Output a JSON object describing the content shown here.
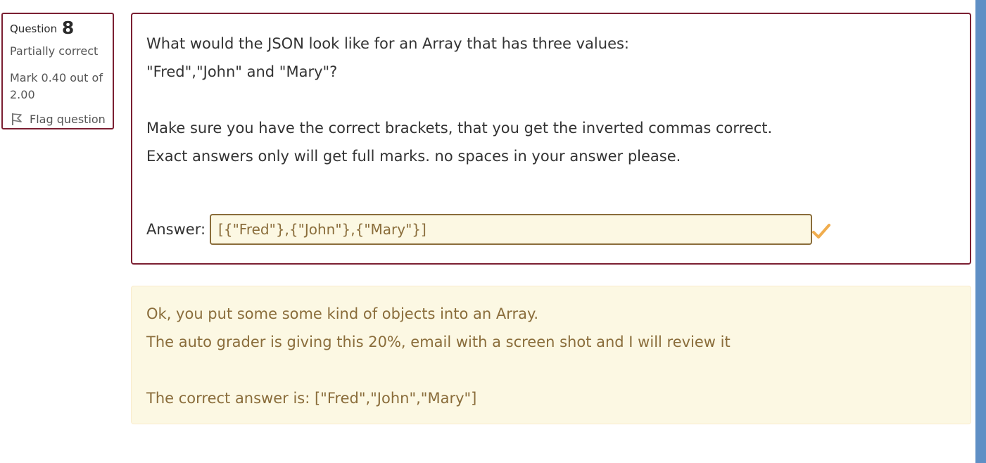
{
  "info": {
    "question_label": "Question",
    "question_number": "8",
    "state": "Partially correct",
    "grade": "Mark 0.40 out of 2.00",
    "flag_label": "Flag question",
    "flag_icon": "flag-icon"
  },
  "question": {
    "line1": "What would the JSON look like for an Array that has three values:",
    "line2": "\"Fred\",\"John\" and \"Mary\"?",
    "line3": "Make sure you have the correct brackets, that you get the inverted commas correct.",
    "line4": "Exact answers only will get full marks. no spaces in your answer please.",
    "answer_label": "Answer:",
    "answer_value": "[{\"Fred\"},{\"John\"},{\"Mary\"}]",
    "status_icon": "check-icon"
  },
  "feedback": {
    "line1": "Ok, you put some some kind of objects into an Array.",
    "line2": "The auto grader is giving this 20%, email with a screen shot and I will review it",
    "right_answer": "The correct answer is: [\"Fred\",\"John\",\"Mary\"]"
  },
  "colors": {
    "question_border": "#7b1f32",
    "partial_text": "#8a6d3b",
    "partial_background": "#fcf8e3",
    "edge_bar": "#5f8fc5",
    "check": "#f0ad4e"
  }
}
